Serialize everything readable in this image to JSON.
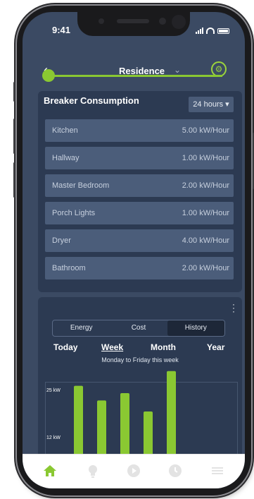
{
  "status": {
    "time": "9:41"
  },
  "header": {
    "title": "Residence"
  },
  "icons": {
    "back": "back-chevron-icon",
    "settings": "gear-icon",
    "dropdown": "chevron-down-icon"
  },
  "accent": "#8ac832",
  "breakers": {
    "title": "Breaker Consumption",
    "range": "24 hours",
    "items": [
      {
        "name": "Kitchen",
        "value": "5.00 kW/Hour"
      },
      {
        "name": "Hallway",
        "value": "1.00 kW/Hour"
      },
      {
        "name": "Master Bedroom",
        "value": "2.00 kW/Hour"
      },
      {
        "name": "Porch Lights",
        "value": "1.00 kW/Hour"
      },
      {
        "name": "Dryer",
        "value": "4.00 kW/Hour"
      },
      {
        "name": "Bathroom",
        "value": "2.00 kW/Hour"
      }
    ]
  },
  "usage": {
    "tabs": [
      "Energy",
      "Cost",
      "History"
    ],
    "active_tab": "History",
    "periods": [
      "Today",
      "Week",
      "Month",
      "Year"
    ],
    "active_period": "Week",
    "subtitle": "Monday to Friday this week"
  },
  "chart_data": {
    "type": "bar",
    "categories": [
      "",
      "",
      "",
      "",
      ""
    ],
    "values": [
      22,
      18,
      20,
      15,
      26
    ],
    "ytick_labels": [
      "25 kW",
      "12 kW"
    ],
    "ylim": [
      0,
      30
    ],
    "color": "#8ac832"
  },
  "tabbar": {
    "items": [
      "home-icon",
      "lightbulb-icon",
      "play-icon",
      "clock-icon",
      "menu-icon"
    ],
    "active": "home-icon"
  }
}
